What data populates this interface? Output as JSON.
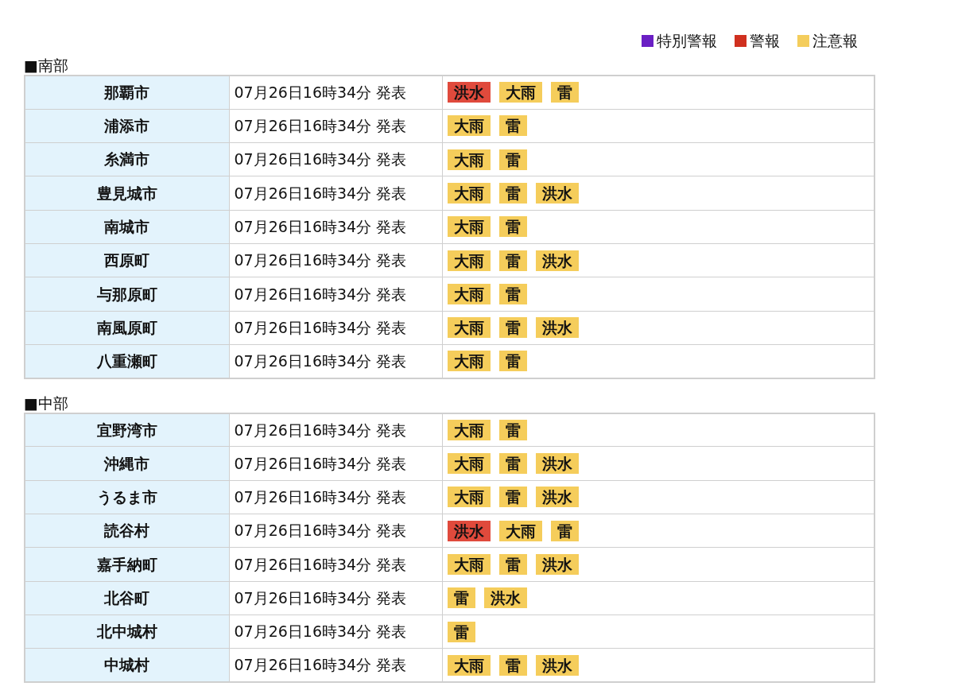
{
  "legend": [
    {
      "label": "特別警報",
      "color": "#6a1fc4"
    },
    {
      "label": "警報",
      "color": "#d0301f"
    },
    {
      "label": "注意報",
      "color": "#f4cd5c"
    }
  ],
  "sections": [
    {
      "title": "■南部",
      "rows": [
        {
          "area": "那覇市",
          "issued": "07月26日16時34分 発表",
          "alerts": [
            {
              "label": "洪水",
              "kind": "warning"
            },
            {
              "label": "大雨",
              "kind": "advisory"
            },
            {
              "label": "雷",
              "kind": "advisory"
            }
          ]
        },
        {
          "area": "浦添市",
          "issued": "07月26日16時34分 発表",
          "alerts": [
            {
              "label": "大雨",
              "kind": "advisory"
            },
            {
              "label": "雷",
              "kind": "advisory"
            }
          ]
        },
        {
          "area": "糸満市",
          "issued": "07月26日16時34分 発表",
          "alerts": [
            {
              "label": "大雨",
              "kind": "advisory"
            },
            {
              "label": "雷",
              "kind": "advisory"
            }
          ]
        },
        {
          "area": "豊見城市",
          "issued": "07月26日16時34分 発表",
          "alerts": [
            {
              "label": "大雨",
              "kind": "advisory"
            },
            {
              "label": "雷",
              "kind": "advisory"
            },
            {
              "label": "洪水",
              "kind": "advisory"
            }
          ]
        },
        {
          "area": "南城市",
          "issued": "07月26日16時34分 発表",
          "alerts": [
            {
              "label": "大雨",
              "kind": "advisory"
            },
            {
              "label": "雷",
              "kind": "advisory"
            }
          ]
        },
        {
          "area": "西原町",
          "issued": "07月26日16時34分 発表",
          "alerts": [
            {
              "label": "大雨",
              "kind": "advisory"
            },
            {
              "label": "雷",
              "kind": "advisory"
            },
            {
              "label": "洪水",
              "kind": "advisory"
            }
          ]
        },
        {
          "area": "与那原町",
          "issued": "07月26日16時34分 発表",
          "alerts": [
            {
              "label": "大雨",
              "kind": "advisory"
            },
            {
              "label": "雷",
              "kind": "advisory"
            }
          ]
        },
        {
          "area": "南風原町",
          "issued": "07月26日16時34分 発表",
          "alerts": [
            {
              "label": "大雨",
              "kind": "advisory"
            },
            {
              "label": "雷",
              "kind": "advisory"
            },
            {
              "label": "洪水",
              "kind": "advisory"
            }
          ]
        },
        {
          "area": "八重瀬町",
          "issued": "07月26日16時34分 発表",
          "alerts": [
            {
              "label": "大雨",
              "kind": "advisory"
            },
            {
              "label": "雷",
              "kind": "advisory"
            }
          ]
        }
      ]
    },
    {
      "title": "■中部",
      "rows": [
        {
          "area": "宜野湾市",
          "issued": "07月26日16時34分 発表",
          "alerts": [
            {
              "label": "大雨",
              "kind": "advisory"
            },
            {
              "label": "雷",
              "kind": "advisory"
            }
          ]
        },
        {
          "area": "沖縄市",
          "issued": "07月26日16時34分 発表",
          "alerts": [
            {
              "label": "大雨",
              "kind": "advisory"
            },
            {
              "label": "雷",
              "kind": "advisory"
            },
            {
              "label": "洪水",
              "kind": "advisory"
            }
          ]
        },
        {
          "area": "うるま市",
          "issued": "07月26日16時34分 発表",
          "alerts": [
            {
              "label": "大雨",
              "kind": "advisory"
            },
            {
              "label": "雷",
              "kind": "advisory"
            },
            {
              "label": "洪水",
              "kind": "advisory"
            }
          ]
        },
        {
          "area": "読谷村",
          "issued": "07月26日16時34分 発表",
          "alerts": [
            {
              "label": "洪水",
              "kind": "warning"
            },
            {
              "label": "大雨",
              "kind": "advisory"
            },
            {
              "label": "雷",
              "kind": "advisory"
            }
          ]
        },
        {
          "area": "嘉手納町",
          "issued": "07月26日16時34分 発表",
          "alerts": [
            {
              "label": "大雨",
              "kind": "advisory"
            },
            {
              "label": "雷",
              "kind": "advisory"
            },
            {
              "label": "洪水",
              "kind": "advisory"
            }
          ]
        },
        {
          "area": "北谷町",
          "issued": "07月26日16時34分 発表",
          "alerts": [
            {
              "label": "雷",
              "kind": "advisory"
            },
            {
              "label": "洪水",
              "kind": "advisory"
            }
          ]
        },
        {
          "area": "北中城村",
          "issued": "07月26日16時34分 発表",
          "alerts": [
            {
              "label": "雷",
              "kind": "advisory"
            }
          ]
        },
        {
          "area": "中城村",
          "issued": "07月26日16時34分 発表",
          "alerts": [
            {
              "label": "大雨",
              "kind": "advisory"
            },
            {
              "label": "雷",
              "kind": "advisory"
            },
            {
              "label": "洪水",
              "kind": "advisory"
            }
          ]
        }
      ]
    }
  ]
}
